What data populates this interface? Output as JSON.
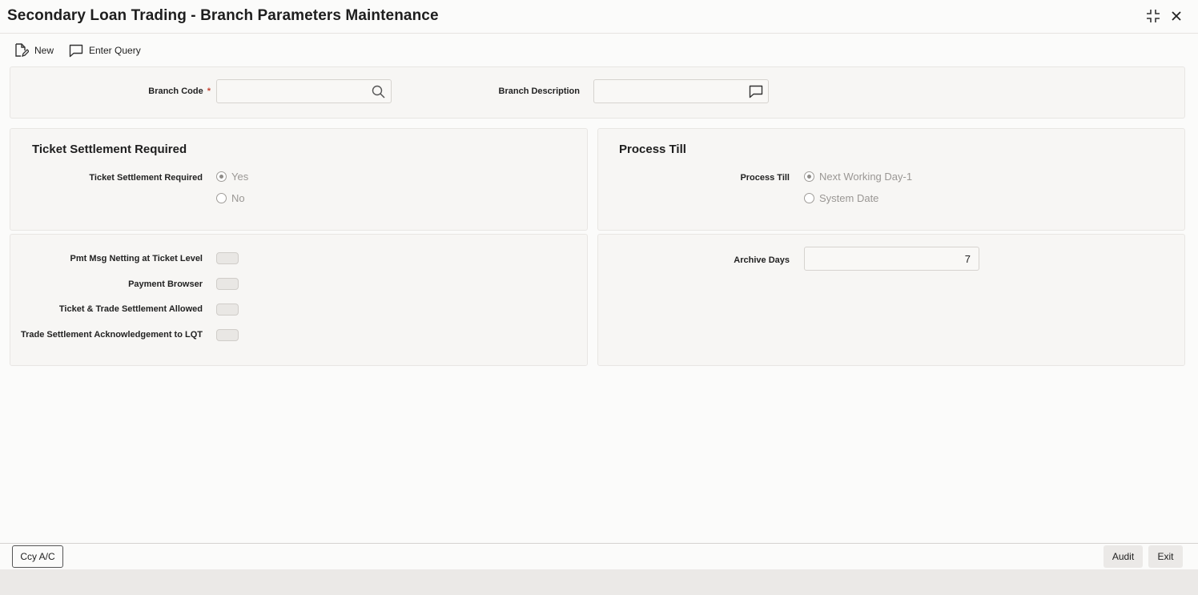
{
  "window": {
    "title": "Secondary Loan Trading - Branch Parameters Maintenance"
  },
  "window_icons": {
    "restore": "shrink-icon",
    "close": "close-icon"
  },
  "toolbar": {
    "new_label": "New",
    "new_icon": "new-document-icon",
    "enter_query_label": "Enter Query",
    "enter_query_icon": "query-icon"
  },
  "header": {
    "branch_code_label": "Branch Code",
    "branch_code_required": "*",
    "branch_code_value": "",
    "branch_code_icon": "search-icon",
    "branch_description_label": "Branch Description",
    "branch_description_value": "",
    "branch_description_icon": "comment-icon"
  },
  "ticket_settlement": {
    "section_title": "Ticket Settlement Required",
    "field_label": "Ticket Settlement Required",
    "options": [
      {
        "label": "Yes",
        "selected": true
      },
      {
        "label": "No",
        "selected": false
      }
    ]
  },
  "process_till": {
    "section_title": "Process Till",
    "field_label": "Process Till",
    "options": [
      {
        "label": "Next Working Day-1",
        "selected": true
      },
      {
        "label": "System Date",
        "selected": false
      }
    ]
  },
  "toggles": [
    {
      "label": "Pmt Msg Netting at Ticket Level",
      "on": false
    },
    {
      "label": "Payment Browser",
      "on": false
    },
    {
      "label": "Ticket & Trade Settlement Allowed",
      "on": false
    },
    {
      "label": "Trade Settlement Acknowledgement to LQT",
      "on": false
    }
  ],
  "archive": {
    "label": "Archive Days",
    "value": "7"
  },
  "footer": {
    "ccy_label": "Ccy A/C",
    "audit_label": "Audit",
    "exit_label": "Exit"
  },
  "colors": {
    "required": "#c74634",
    "background": "#fbfbfa"
  }
}
